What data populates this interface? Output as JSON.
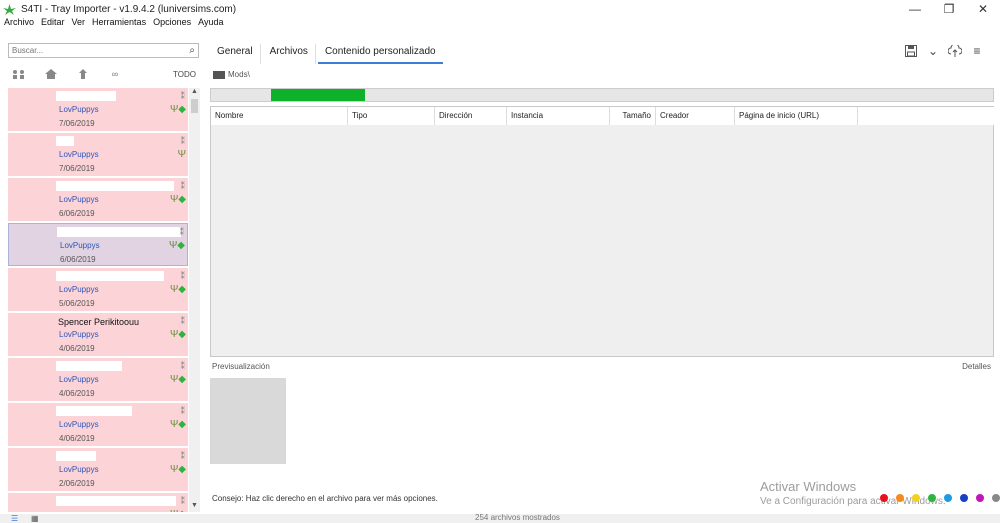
{
  "window": {
    "title": "S4TI - Tray Importer - v1.9.4.2  (luniversims.com)",
    "controls": [
      "—",
      "❐",
      "✕"
    ]
  },
  "menu": [
    "Archivo",
    "Editar",
    "Ver",
    "Herramientas",
    "Opciones",
    "Ayuda"
  ],
  "search": {
    "placeholder": "Buscar...",
    "value": ""
  },
  "filters": {
    "all_label": "TODO",
    "icons": [
      "household-icon",
      "lot-icon",
      "room-icon",
      "infinity-icon"
    ]
  },
  "items": [
    {
      "name": "",
      "author": "LovPuppys",
      "date": "7/06/2019",
      "selected": false,
      "tagged": true
    },
    {
      "name": "",
      "author": "LovPuppys",
      "date": "7/06/2019",
      "selected": false,
      "tagged": false
    },
    {
      "name": "",
      "author": "LovPuppys",
      "date": "6/06/2019",
      "selected": false,
      "tagged": true
    },
    {
      "name": "",
      "author": "LovPuppys",
      "date": "6/06/2019",
      "selected": true,
      "tagged": true
    },
    {
      "name": "",
      "author": "LovPuppys",
      "date": "5/06/2019",
      "selected": false,
      "tagged": true
    },
    {
      "name": "Spencer Perikitoouu",
      "author": "LovPuppys",
      "date": "4/06/2019",
      "selected": false,
      "tagged": true
    },
    {
      "name": "",
      "author": "LovPuppys",
      "date": "4/06/2019",
      "selected": false,
      "tagged": true
    },
    {
      "name": "",
      "author": "LovPuppys",
      "date": "4/06/2019",
      "selected": false,
      "tagged": true
    },
    {
      "name": "",
      "author": "LovPuppys",
      "date": "2/06/2019",
      "selected": false,
      "tagged": true
    },
    {
      "name": "",
      "author": "",
      "date": "",
      "selected": false,
      "tagged": true
    }
  ],
  "tabs": [
    {
      "label": "General",
      "active": false
    },
    {
      "label": "Archivos",
      "active": false
    },
    {
      "label": "Contenido personalizado",
      "active": true
    }
  ],
  "path": "Mods\\",
  "progress": 0.12,
  "columns": [
    "Nombre",
    "Tipo",
    "Dirección",
    "Instancia",
    "Tamaño",
    "Creador",
    "Página de inicio (URL)"
  ],
  "preview_label": "Previsualización",
  "details_label": "Detalles",
  "tip": "Consejo:  Haz clic derecho en el archivo para ver más opciones.",
  "watermark": {
    "line1": "Activar Windows",
    "line2": "Ve a Configuración para activar Windows."
  },
  "color_dots": [
    "#e8121f",
    "#f58a1d",
    "#f5d01d",
    "#2db43e",
    "#1e9be0",
    "#1a3fc7",
    "#c215b8",
    "#888888"
  ],
  "status": "254 archivos mostrados"
}
